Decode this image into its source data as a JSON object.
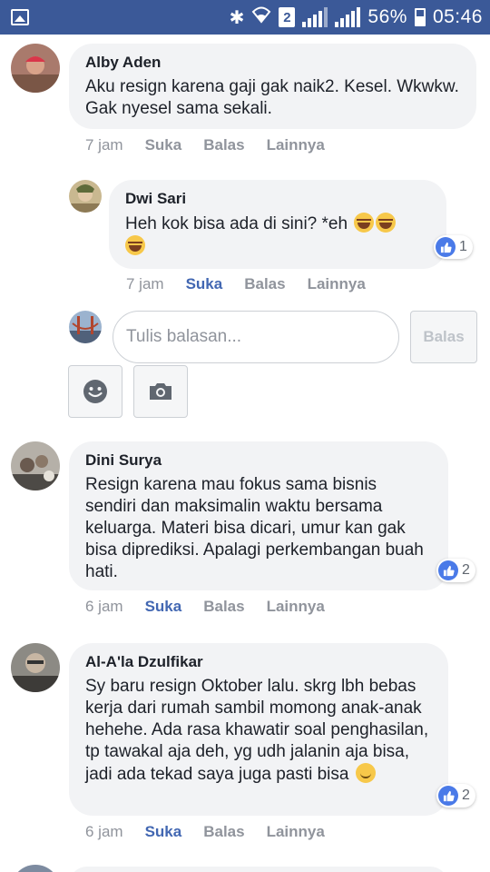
{
  "status_bar": {
    "battery": "56%",
    "time": "05:46",
    "sim": "2"
  },
  "comments": [
    {
      "author": "Alby Aden",
      "text": "Aku resign karena gaji gak naik2. Kesel. Wkwkw. Gak nyesel sama sekali.",
      "time": "7 jam",
      "like": "Suka",
      "reply": "Balas",
      "more": "Lainnya"
    },
    {
      "author": "Dwi Sari",
      "text": "Heh kok bisa ada di sini? *eh",
      "time": "7 jam",
      "like": "Suka",
      "reply": "Balas",
      "more": "Lainnya",
      "reaction_count": "1"
    },
    {
      "author": "Dini Surya",
      "text": "Resign karena mau fokus sama bisnis sendiri dan maksimalin waktu bersama keluarga. Materi bisa dicari, umur kan gak bisa diprediksi. Apalagi perkembangan buah hati.",
      "time": "6 jam",
      "like": "Suka",
      "reply": "Balas",
      "more": "Lainnya",
      "reaction_count": "2"
    },
    {
      "author": "Al-A'la Dzulfikar",
      "text": "Sy baru resign Oktober lalu. skrg lbh bebas kerja dari rumah sambil momong anak-anak hehehe. Ada rasa khawatir soal penghasilan, tp tawakal aja deh, yg udh jalanin aja bisa, jadi ada tekad saya juga pasti bisa",
      "time": "6 jam",
      "like": "Suka",
      "reply": "Balas",
      "more": "Lainnya",
      "reaction_count": "2"
    }
  ],
  "reply_box": {
    "placeholder": "Tulis balasan...",
    "send_label": "Balas"
  },
  "colors": {
    "status_bar": "#3b5998",
    "liked": "#4267b2",
    "bubble": "#f2f3f5",
    "muted": "#90949c"
  },
  "icons": [
    "gallery-icon",
    "bluetooth-icon",
    "wifi-icon",
    "sim-icon",
    "signal-icon",
    "battery-icon",
    "like-icon",
    "laughing-emoji-icon",
    "smile-emoji-icon",
    "emoji-button-icon",
    "camera-icon"
  ]
}
